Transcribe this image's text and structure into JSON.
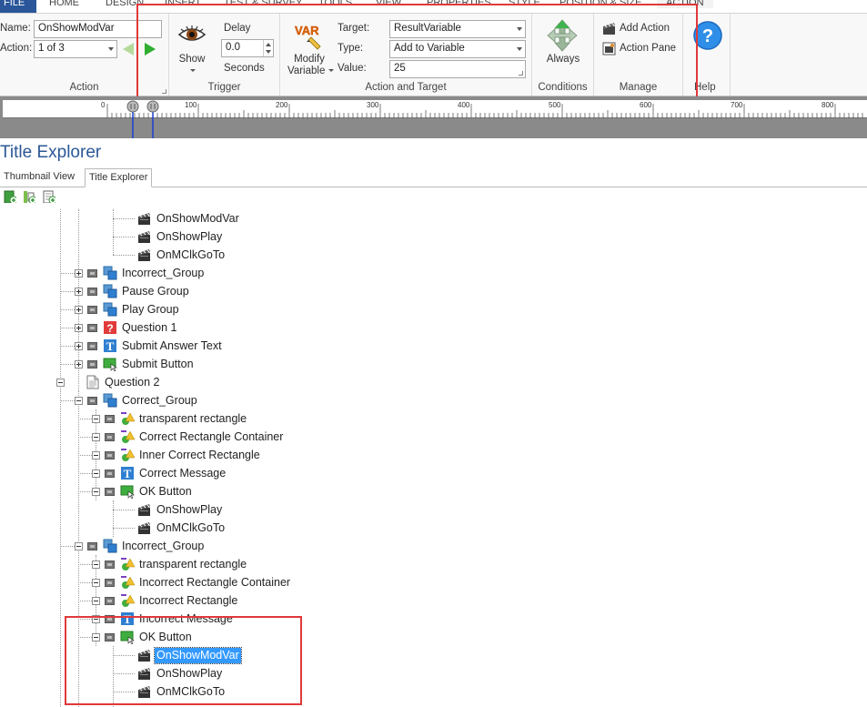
{
  "menu": {
    "tabs": [
      "FILE",
      "HOME",
      "DESIGN",
      "INSERT",
      "TEST & SURVEY",
      "TOOLS",
      "VIEW",
      "PROPERTIES",
      "STYLE",
      "POSITION & SIZE",
      "ACTION"
    ]
  },
  "ribbon": {
    "action_group": {
      "name_label": "Name:",
      "name_value": "OnShowModVar",
      "action_label": "Action:",
      "action_value": "1 of 3",
      "group_label": "Action"
    },
    "trigger_group": {
      "show_label": "Show",
      "delay_label": "Delay",
      "delay_value": "0.0",
      "seconds_label": "Seconds",
      "group_label": "Trigger"
    },
    "action_target_group": {
      "modify_label": "Modify",
      "variable_label": "Variable",
      "var_icon_text": "VAR",
      "target_label": "Target:",
      "target_value": "ResultVariable",
      "type_label": "Type:",
      "type_value": "Add to Variable",
      "value_label": "Value:",
      "value_value": "25",
      "group_label": "Action and Target"
    },
    "conditions_group": {
      "always_label": "Always",
      "group_label": "Conditions"
    },
    "manage_group": {
      "add_action_label": "Add Action",
      "action_pane_label": "Action Pane",
      "group_label": "Manage"
    },
    "help_group": {
      "group_label": "Help"
    },
    "colors": {
      "highlight": "#e0393b",
      "accent": "#2b579a"
    }
  },
  "timeline": {
    "tick_labels": [
      "0",
      "100",
      "200",
      "300",
      "400",
      "500",
      "600",
      "700",
      "800"
    ]
  },
  "explorer": {
    "title": "Title Explorer",
    "tabs": [
      "Thumbnail View",
      "Title Explorer"
    ],
    "active_tab": "Title Explorer",
    "tree": [
      {
        "label": "OnShowModVar",
        "icon": "clapper-icon",
        "level": 4
      },
      {
        "label": "OnShowPlay",
        "icon": "clapper-icon",
        "level": 4
      },
      {
        "label": "OnMClkGoTo",
        "icon": "clapper-icon",
        "level": 4
      },
      {
        "label": "Incorrect_Group",
        "icon": "group-icon",
        "level": 2
      },
      {
        "label": "Pause Group",
        "icon": "group-icon",
        "level": 2
      },
      {
        "label": "Play Group",
        "icon": "group-icon",
        "level": 2
      },
      {
        "label": "Question 1",
        "icon": "question-icon",
        "level": 2
      },
      {
        "label": "Submit Answer Text",
        "icon": "text-icon",
        "level": 2
      },
      {
        "label": "Submit Button",
        "icon": "button-icon",
        "level": 2
      },
      {
        "label": "Question 2",
        "icon": "page-icon",
        "level": 1
      },
      {
        "label": "Correct_Group",
        "icon": "group-icon",
        "level": 2
      },
      {
        "label": "transparent rectangle",
        "icon": "shape-icon",
        "level": 3
      },
      {
        "label": "Correct Rectangle Container",
        "icon": "shape-icon",
        "level": 3
      },
      {
        "label": "Inner Correct Rectangle",
        "icon": "shape-icon",
        "level": 3
      },
      {
        "label": "Correct Message",
        "icon": "text-icon",
        "level": 3
      },
      {
        "label": "OK Button",
        "icon": "button-icon",
        "level": 3
      },
      {
        "label": "OnShowPlay",
        "icon": "clapper-icon",
        "level": 4
      },
      {
        "label": "OnMClkGoTo",
        "icon": "clapper-icon",
        "level": 4
      },
      {
        "label": "Incorrect_Group",
        "icon": "group-icon",
        "level": 2
      },
      {
        "label": "transparent rectangle",
        "icon": "shape-icon",
        "level": 3
      },
      {
        "label": "Incorrect Rectangle Container",
        "icon": "shape-icon",
        "level": 3
      },
      {
        "label": "Incorrect Rectangle",
        "icon": "shape-icon",
        "level": 3
      },
      {
        "label": "Incorrect Message",
        "icon": "text-icon",
        "level": 3
      },
      {
        "label": "OK Button",
        "icon": "button-icon",
        "level": 3
      },
      {
        "label": "OnShowModVar",
        "icon": "clapper-icon",
        "level": 4,
        "selected": true
      },
      {
        "label": "OnShowPlay",
        "icon": "clapper-icon",
        "level": 4
      },
      {
        "label": "OnMClkGoTo",
        "icon": "clapper-icon",
        "level": 4
      }
    ]
  }
}
